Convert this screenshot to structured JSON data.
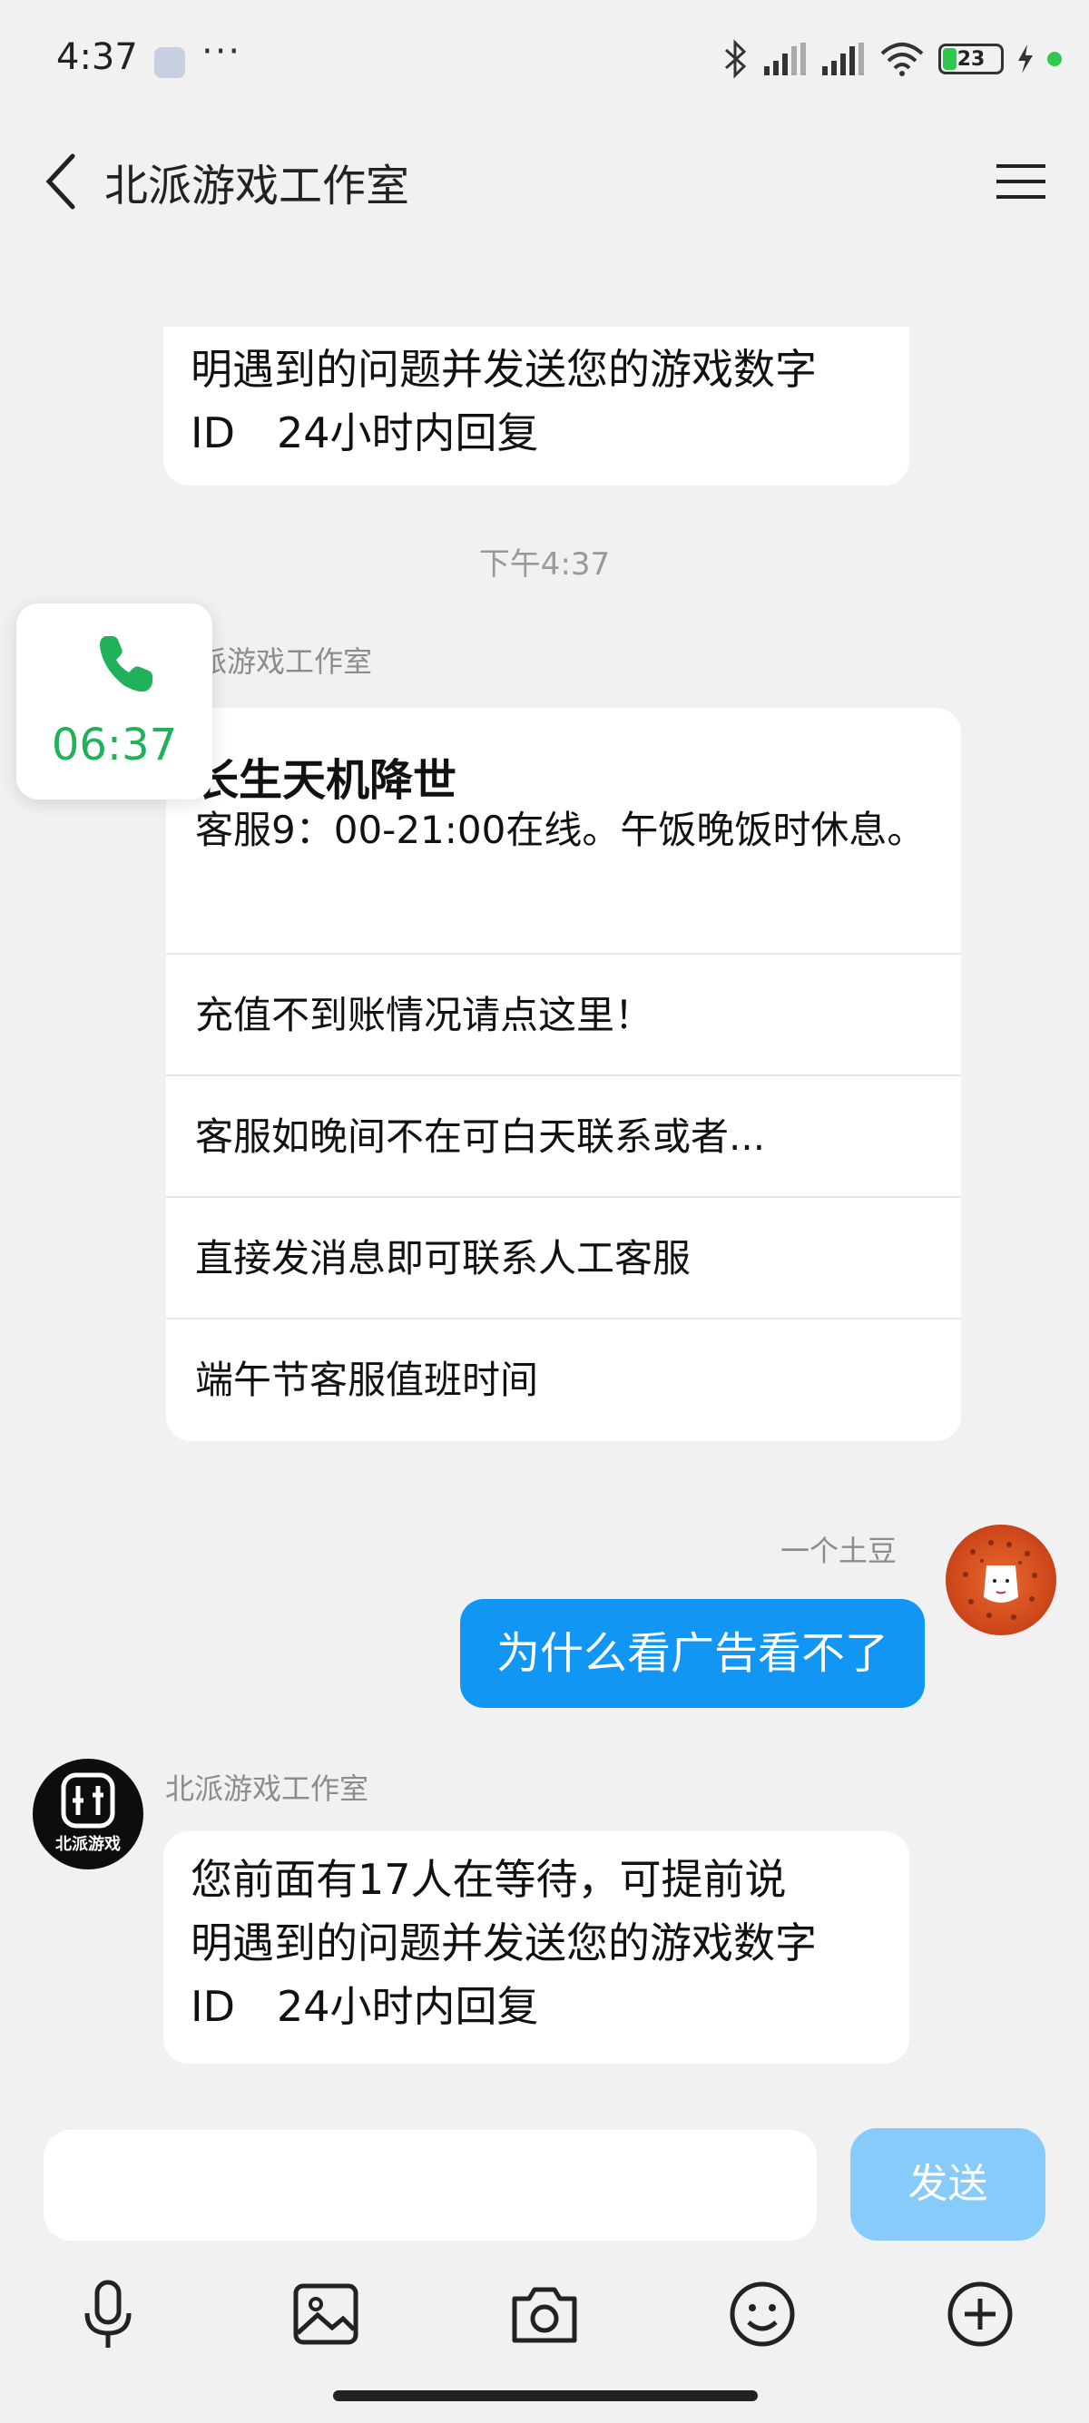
{
  "status_bar": {
    "time": "4:37",
    "more": "···",
    "battery_level": "23",
    "battery_percent": 23
  },
  "header": {
    "title": "北派游戏工作室"
  },
  "messages": {
    "top_bubble_line1": "明遇到的问题并发送您的游戏数字",
    "top_bubble_line2": "ID　24小时内回复",
    "timestamp": "下午4:37",
    "bot_sender_partial": "派游戏工作室",
    "card": {
      "title": "长生天机降世",
      "subtitle": "客服9：00-21:00在线。午饭晚饭时休息。",
      "items": [
        "充值不到账情况请点这里！",
        "客服如晚间不在可白天联系或者...",
        "直接发消息即可联系人工客服",
        "端午节客服值班时间"
      ]
    },
    "user_name": "一个土豆",
    "user_message": "为什么看广告看不了",
    "bot_sender": "北派游戏工作室",
    "bot_avatar_text": "北派游戏",
    "bot_reply_line1": "您前面有17人在等待，可提前说",
    "bot_reply_line2": "明遇到的问题并发送您的游戏数字",
    "bot_reply_line3": "ID　24小时内回复"
  },
  "call_float": {
    "duration": "06:37"
  },
  "composer": {
    "input_value": "",
    "send_label": "发送",
    "tools": [
      "microphone-icon",
      "image-icon",
      "camera-icon",
      "emoji-icon",
      "plus-icon"
    ]
  },
  "colors": {
    "accent": "#1296f4",
    "send_disabled": "#86cbfa",
    "call_green": "#20b15a",
    "background": "#f1f1f1"
  }
}
